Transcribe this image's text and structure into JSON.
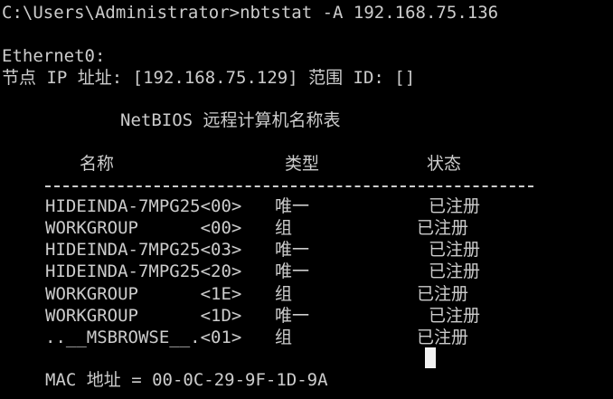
{
  "console": {
    "prompt_line": "C:\\Users\\Administrator>nbtstat -A 192.168.75.136",
    "adapter_name": "Ethernet0:",
    "node_ip_line": "节点 IP 址址: [192.168.75.129] 范围 ID: []",
    "table_title": "NetBIOS 远程计算机名称表",
    "headers": {
      "name": "名称",
      "type": "类型",
      "status": "状态"
    },
    "rows": [
      {
        "name": "HIDEINDA-7MPG25<00>",
        "type": "唯一",
        "status": "已注册"
      },
      {
        "name": "WORKGROUP      <00>",
        "type": "组",
        "status": "已注册"
      },
      {
        "name": "HIDEINDA-7MPG25<03>",
        "type": "唯一",
        "status": "已注册"
      },
      {
        "name": "HIDEINDA-7MPG25<20>",
        "type": "唯一",
        "status": "已注册"
      },
      {
        "name": "WORKGROUP      <1E>",
        "type": "组",
        "status": "已注册"
      },
      {
        "name": "WORKGROUP      <1D>",
        "type": "唯一",
        "status": "已注册"
      },
      {
        "name": "..__MSBROWSE__.<01>",
        "type": "组",
        "status": "已注册"
      }
    ],
    "mac_line": "MAC 地址 = 00-0C-29-9F-1D-9A"
  },
  "colors": {
    "background": "#000000",
    "text": "#cccccc",
    "cursor": "#f2f2f2"
  }
}
